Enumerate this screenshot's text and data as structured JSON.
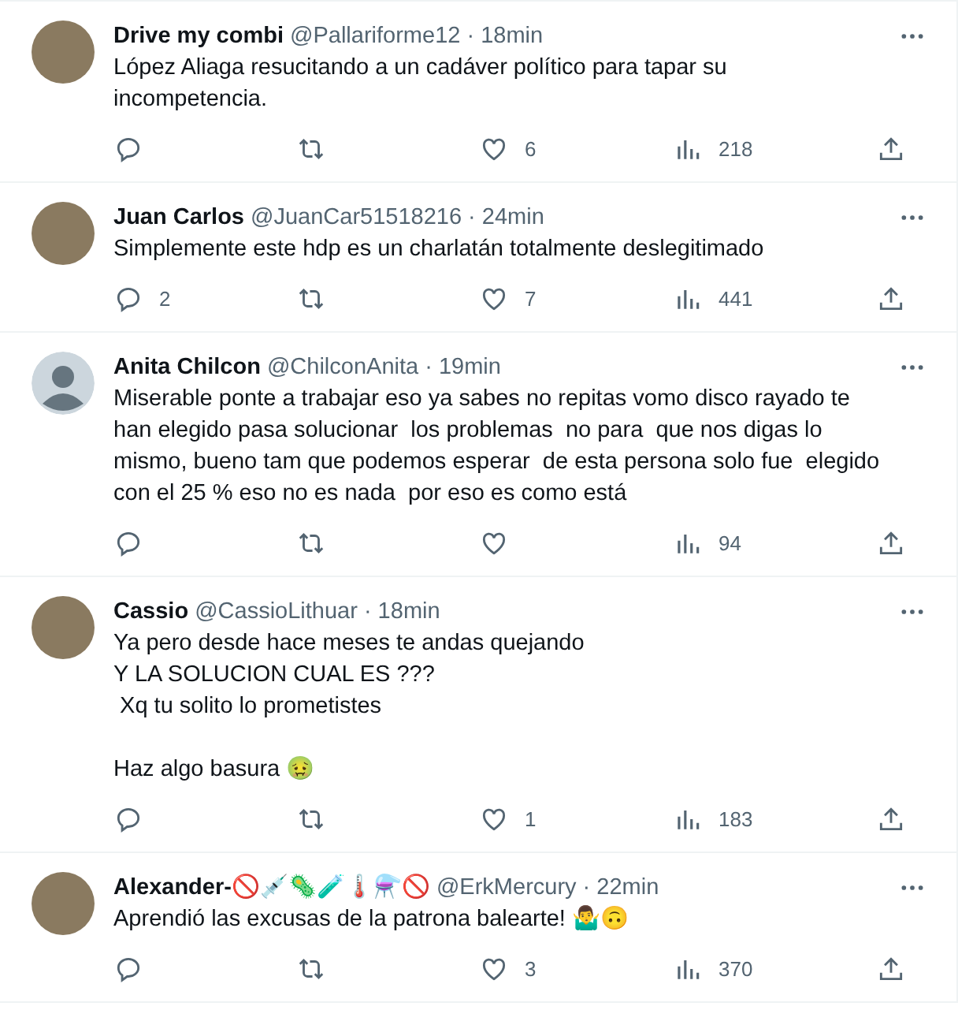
{
  "tweets": [
    {
      "default_avatar": false,
      "name": "Drive my combi",
      "handle": "@Pallariforme12",
      "time": "· 18min",
      "paragraphs": [
        [
          "López Aliaga resucitando a un cadáver político para tapar su incompetencia."
        ]
      ],
      "likes": "6",
      "views": "218"
    },
    {
      "default_avatar": false,
      "name": "Juan Carlos",
      "handle": "@JuanCar51518216",
      "time": "· 24min",
      "paragraphs": [
        [
          "Simplemente este hdp es un charlatán totalmente deslegitimado"
        ]
      ],
      "replies": "2",
      "likes": "7",
      "views": "441"
    },
    {
      "default_avatar": true,
      "name": "Anita Chilcon",
      "handle": "@ChilconAnita",
      "time": "· 19min",
      "paragraphs": [
        [
          "Miserable ponte a trabajar eso ya sabes no repitas vomo disco rayado te han elegido pasa solucionar  los problemas  no para  que nos digas lo mismo, bueno tam que podemos esperar  de esta persona solo fue  elegido con el 25 % eso no es nada  por eso es como está"
        ]
      ],
      "views": "94"
    },
    {
      "default_avatar": false,
      "name": "Cassio",
      "handle": "@CassioLithuar",
      "time": "· 18min",
      "paragraphs": [
        [
          "Ya pero desde hace meses te andas quejando",
          "Y LA SOLUCION CUAL ES ???",
          " Xq tu solito lo prometistes"
        ],
        [
          "Haz algo basura 🤢"
        ]
      ],
      "likes": "1",
      "views": "183"
    },
    {
      "default_avatar": false,
      "name": "Alexander-🚫💉🦠🧪🌡️⚗️🚫",
      "handle": "@ErkMercury",
      "time": "· 22min",
      "paragraphs": [
        [
          "Aprendió las excusas de la patrona balearte! 🤷‍♂️🙃"
        ]
      ],
      "likes": "3",
      "views": "370"
    }
  ]
}
